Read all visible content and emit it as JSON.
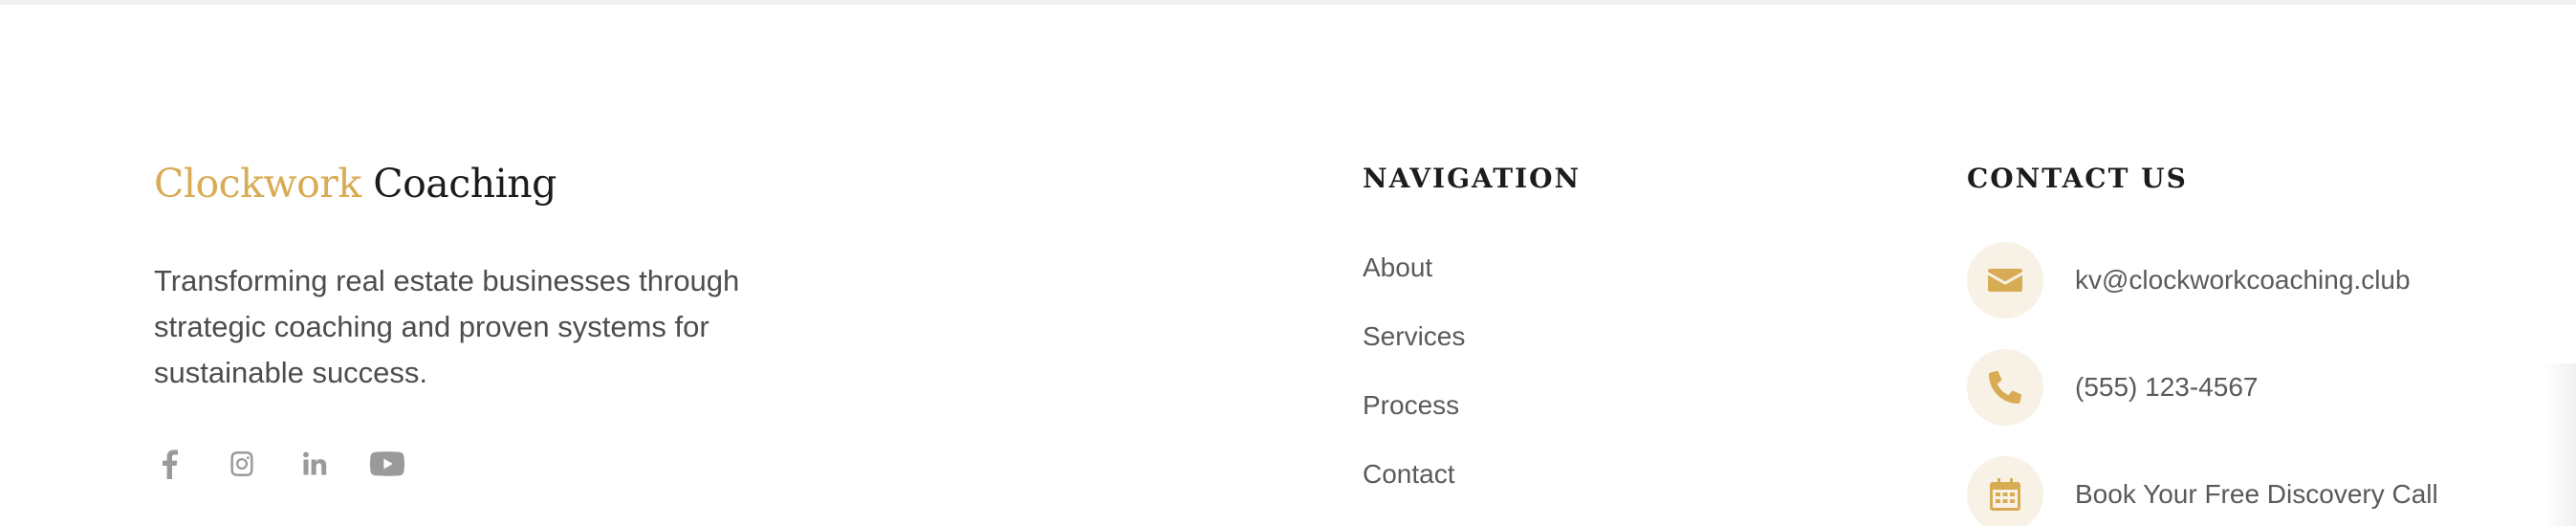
{
  "brand": {
    "accent_text": "Clockwork",
    "dark_text": "Coaching",
    "accent_color": "#d8ac55"
  },
  "tagline": "Transforming real estate businesses through strategic coaching and proven systems for sustainable success.",
  "social": [
    {
      "icon": "facebook-icon"
    },
    {
      "icon": "instagram-icon"
    },
    {
      "icon": "linkedin-icon"
    },
    {
      "icon": "youtube-icon"
    }
  ],
  "navigation": {
    "heading": "NAVIGATION",
    "items": [
      "About",
      "Services",
      "Process",
      "Contact"
    ]
  },
  "contact": {
    "heading": "CONTACT US",
    "email": {
      "icon": "envelope-icon",
      "text": "kv@clockworkcoaching.club"
    },
    "phone": {
      "icon": "phone-icon",
      "text": "(555) 123-4567"
    },
    "booking": {
      "icon": "calendar-icon",
      "text": "Book Your Free Discovery Call"
    }
  }
}
